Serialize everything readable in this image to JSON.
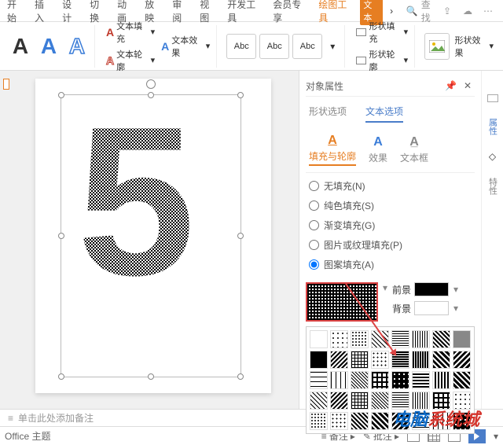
{
  "menubar": {
    "items": [
      "开始",
      "插入",
      "设计",
      "切换",
      "动画",
      "放映",
      "审阅",
      "视图",
      "开发工具",
      "会员专享",
      "绘图工具"
    ],
    "active_index": 10,
    "badge": "文本",
    "search_placeholder": "查找"
  },
  "ribbon": {
    "text_fill": "文本填充",
    "text_outline": "文本轮廓",
    "text_effects": "文本效果",
    "abc": "Abc",
    "shape_fill": "形状填充",
    "shape_outline": "形状轮廓",
    "shape_effects": "形状效果"
  },
  "canvas": {
    "glyph": "5"
  },
  "panel": {
    "title": "对象属性",
    "tabs": {
      "shape": "形状选项",
      "text": "文本选项",
      "active": "text"
    },
    "subtabs": {
      "fill_outline": "填充与轮廓",
      "effects": "效果",
      "textbox": "文本框",
      "active": "fill_outline"
    },
    "radios": {
      "none": "无填充(N)",
      "solid": "纯色填充(S)",
      "gradient": "渐变填充(G)",
      "picture": "图片或纹理填充(P)",
      "pattern": "图案填充(A)",
      "selected": "pattern"
    },
    "foreground": "前景",
    "background": "背景",
    "fg_color": "#000000",
    "bg_color": "#ffffff"
  },
  "side_tabs": {
    "props": "属性",
    "special": "特性"
  },
  "notes": {
    "placeholder": "单击此处添加备注"
  },
  "statusbar": {
    "theme": "Office 主题",
    "notes_btn": "备注",
    "comments_btn": "批注"
  },
  "watermark": {
    "t1": "电脑",
    "t2": "系统城"
  }
}
